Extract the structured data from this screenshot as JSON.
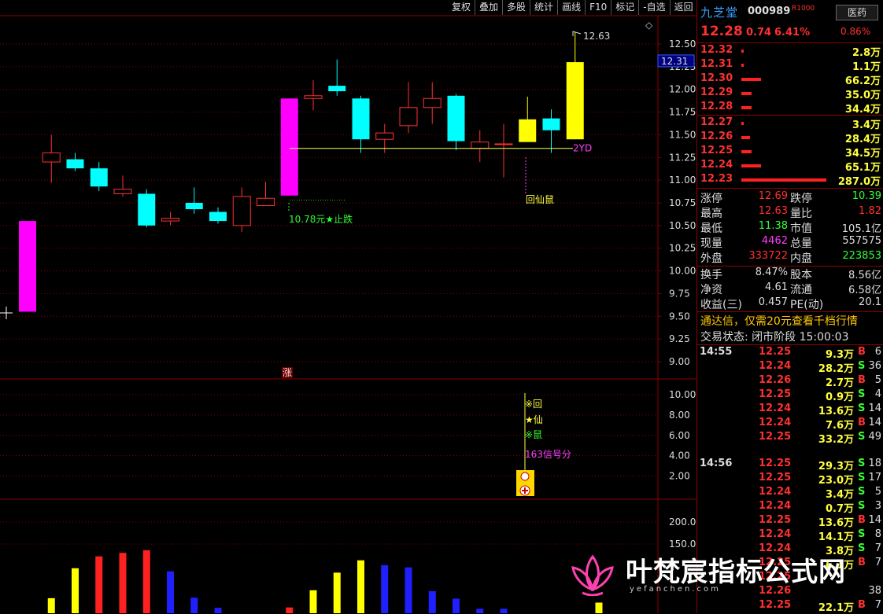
{
  "toolbar": [
    "复权",
    "叠加",
    "多股",
    "统计",
    "画线",
    "F10",
    "标记",
    "-自选",
    "返回"
  ],
  "stock": {
    "name": "九芝堂",
    "code": "000989",
    "tag": "R1000",
    "price": "12.28",
    "change": "0.74",
    "pct": "6.41%",
    "industry": "医药",
    "industry_pct": "0.86%"
  },
  "asks": [
    {
      "price": "12.32",
      "vol": "2.8万",
      "bar": 0.01
    },
    {
      "price": "12.31",
      "vol": "1.1万",
      "bar": 0.004
    },
    {
      "price": "12.30",
      "vol": "66.2万",
      "bar": 0.23
    },
    {
      "price": "12.29",
      "vol": "35.0万",
      "bar": 0.12
    },
    {
      "price": "12.28",
      "vol": "34.4万",
      "bar": 0.12
    }
  ],
  "bids": [
    {
      "price": "12.27",
      "vol": "3.4万",
      "bar": 0.012
    },
    {
      "price": "12.26",
      "vol": "28.4万",
      "bar": 0.1
    },
    {
      "price": "12.25",
      "vol": "34.5万",
      "bar": 0.12
    },
    {
      "price": "12.24",
      "vol": "65.1万",
      "bar": 0.23
    },
    {
      "price": "12.23",
      "vol": "287.0万",
      "bar": 1.0
    }
  ],
  "stats": [
    {
      "l1": "涨停",
      "v1": "12.69",
      "c1": "#ff3030",
      "l2": "跌停",
      "v2": "10.39",
      "c2": "#30ff30"
    },
    {
      "l1": "最高",
      "v1": "12.63",
      "c1": "#ff3030",
      "l2": "量比",
      "v2": "1.82",
      "c2": "#ff3030"
    },
    {
      "l1": "最低",
      "v1": "11.38",
      "c1": "#30ff30",
      "l2": "市值",
      "v2": "105.1亿",
      "c2": "#ddd"
    },
    {
      "l1": "现量",
      "v1": "4462",
      "c1": "#ff40ff",
      "l2": "总量",
      "v2": "557575",
      "c2": "#ddd"
    },
    {
      "l1": "外盘",
      "v1": "333722",
      "c1": "#ff3030",
      "l2": "内盘",
      "v2": "223853",
      "c2": "#30ff30"
    }
  ],
  "stats2": [
    {
      "l1": "换手",
      "v1": "8.47%",
      "c1": "#ddd",
      "l2": "股本",
      "v2": "8.56亿",
      "c2": "#ddd"
    },
    {
      "l1": "净资",
      "v1": "4.61",
      "c1": "#ddd",
      "l2": "流通",
      "v2": "6.58亿",
      "c2": "#ddd"
    },
    {
      "l1": "收益(三)",
      "v1": "0.457",
      "c1": "#ddd",
      "l2": "PE(动)",
      "v2": "20.1",
      "c2": "#ddd"
    }
  ],
  "banner": "通达信，仅需20元查看千档行情",
  "trade_state": "交易状态: 闭市阶段 15:00:03",
  "ticks": [
    {
      "t": "14:55",
      "p": "12.25",
      "v": "9.3万",
      "bs": "B",
      "n": "6"
    },
    {
      "t": "",
      "p": "12.24",
      "v": "28.2万",
      "bs": "S",
      "n": "36"
    },
    {
      "t": "",
      "p": "12.26",
      "v": "2.7万",
      "bs": "B",
      "n": "5"
    },
    {
      "t": "",
      "p": "12.25",
      "v": "0.9万",
      "bs": "S",
      "n": "4"
    },
    {
      "t": "",
      "p": "12.24",
      "v": "13.6万",
      "bs": "S",
      "n": "14"
    },
    {
      "t": "",
      "p": "12.24",
      "v": "7.6万",
      "bs": "B",
      "n": "14"
    },
    {
      "t": "",
      "p": "12.25",
      "v": "33.2万",
      "bs": "S",
      "n": "49"
    },
    {
      "t": "14:56",
      "p": "12.25",
      "v": "29.3万",
      "bs": "S",
      "n": "18"
    },
    {
      "t": "",
      "p": "12.25",
      "v": "23.0万",
      "bs": "S",
      "n": "17"
    },
    {
      "t": "",
      "p": "12.24",
      "v": "3.4万",
      "bs": "S",
      "n": "5"
    },
    {
      "t": "",
      "p": "12.24",
      "v": "0.7万",
      "bs": "S",
      "n": "3"
    },
    {
      "t": "",
      "p": "12.25",
      "v": "13.6万",
      "bs": "B",
      "n": "14"
    },
    {
      "t": "",
      "p": "12.24",
      "v": "14.1万",
      "bs": "S",
      "n": "8"
    },
    {
      "t": "",
      "p": "12.24",
      "v": "3.8万",
      "bs": "S",
      "n": "7"
    },
    {
      "t": "",
      "p": "12.25",
      "v": "6.1万",
      "bs": "B",
      "n": "7"
    },
    {
      "t": "",
      "p": "12.25",
      "v": "",
      "bs": "",
      "n": ""
    },
    {
      "t": "",
      "p": "12.26",
      "v": "",
      "bs": "",
      "n": "38"
    },
    {
      "t": "",
      "p": "12.25",
      "v": "22.1万",
      "bs": "B",
      "n": "7"
    }
  ],
  "main_axis": [
    "12.50",
    "12.25",
    "12.00",
    "11.75",
    "11.50",
    "11.25",
    "11.00",
    "10.75",
    "10.50",
    "10.25",
    "10.00",
    "9.75",
    "9.50",
    "9.25",
    "9.00"
  ],
  "sig_axis": [
    "10.00",
    "8.00",
    "6.00",
    "4.00",
    "2.00"
  ],
  "vol_axis": [
    "200.0",
    "150.0"
  ],
  "current_price_tag": "12.31",
  "labels": {
    "high": "12.63",
    "yd": "2YD",
    "stop": "10.78元★止跌",
    "hxs": "回仙鼠",
    "zhang": "涨",
    "s1": "※回",
    "s2": "★仙",
    "s3": "※鼠",
    "score": "163信号分"
  },
  "candles": [
    {
      "o": 9.55,
      "c": 10.55,
      "h": 10.55,
      "l": 9.55,
      "col": "magenta"
    },
    {
      "o": 11.2,
      "c": 11.3,
      "h": 11.5,
      "l": 10.97,
      "col": "red"
    },
    {
      "o": 11.23,
      "c": 11.13,
      "h": 11.3,
      "l": 11.1,
      "col": "cyan"
    },
    {
      "o": 11.13,
      "c": 10.93,
      "h": 11.2,
      "l": 10.88,
      "col": "cyan"
    },
    {
      "o": 10.85,
      "c": 10.9,
      "h": 11.05,
      "l": 10.82,
      "col": "red"
    },
    {
      "o": 10.85,
      "c": 10.5,
      "h": 10.9,
      "l": 10.48,
      "col": "cyan"
    },
    {
      "o": 10.55,
      "c": 10.58,
      "h": 10.65,
      "l": 10.5,
      "col": "red"
    },
    {
      "o": 10.75,
      "c": 10.68,
      "h": 10.92,
      "l": 10.63,
      "col": "cyan"
    },
    {
      "o": 10.65,
      "c": 10.55,
      "h": 10.7,
      "l": 10.52,
      "col": "cyan"
    },
    {
      "o": 10.5,
      "c": 10.82,
      "h": 10.92,
      "l": 10.43,
      "col": "red"
    },
    {
      "o": 10.72,
      "c": 10.8,
      "h": 10.98,
      "l": 10.72,
      "col": "red"
    },
    {
      "o": 10.83,
      "c": 11.9,
      "h": 11.9,
      "l": 10.83,
      "col": "magenta"
    },
    {
      "o": 11.9,
      "c": 11.93,
      "h": 12.1,
      "l": 11.77,
      "col": "red"
    },
    {
      "o": 12.04,
      "c": 11.98,
      "h": 12.33,
      "l": 11.93,
      "col": "cyan"
    },
    {
      "o": 11.9,
      "c": 11.45,
      "h": 11.93,
      "l": 11.3,
      "col": "cyan"
    },
    {
      "o": 11.45,
      "c": 11.52,
      "h": 11.62,
      "l": 11.3,
      "col": "red"
    },
    {
      "o": 11.6,
      "c": 11.8,
      "h": 12.08,
      "l": 11.52,
      "col": "red"
    },
    {
      "o": 11.8,
      "c": 11.9,
      "h": 12.08,
      "l": 11.62,
      "col": "red"
    },
    {
      "o": 11.93,
      "c": 11.43,
      "h": 11.95,
      "l": 11.33,
      "col": "cyan"
    },
    {
      "o": 11.35,
      "c": 11.42,
      "h": 11.55,
      "l": 11.2,
      "col": "red"
    },
    {
      "o": 11.4,
      "c": 11.4,
      "h": 11.62,
      "l": 11.03,
      "col": "red"
    },
    {
      "o": 11.42,
      "c": 11.67,
      "h": 11.92,
      "l": 11.42,
      "col": "yellow"
    },
    {
      "o": 11.68,
      "c": 11.55,
      "h": 11.78,
      "l": 11.3,
      "col": "cyan"
    },
    {
      "o": 11.45,
      "c": 12.3,
      "h": 12.63,
      "l": 11.45,
      "col": "yellow"
    }
  ],
  "volume_bars": [
    {
      "v": 27,
      "col": "yellow"
    },
    {
      "v": 95,
      "col": "yellow"
    },
    {
      "v": 122,
      "col": "red"
    },
    {
      "v": 130,
      "col": "red"
    },
    {
      "v": 136,
      "col": "red"
    },
    {
      "v": 88,
      "col": "blue"
    },
    {
      "v": 28,
      "col": "blue"
    },
    {
      "v": 5,
      "col": "blue"
    },
    {
      "v": 0,
      "col": "blue"
    },
    {
      "v": 0,
      "col": "blue"
    },
    {
      "v": 6,
      "col": "red"
    },
    {
      "v": 45,
      "col": "yellow"
    },
    {
      "v": 85,
      "col": "yellow"
    },
    {
      "v": 113,
      "col": "yellow"
    },
    {
      "v": 102,
      "col": "blue"
    },
    {
      "v": 97,
      "col": "blue"
    },
    {
      "v": 43,
      "col": "blue"
    },
    {
      "v": 26,
      "col": "blue"
    },
    {
      "v": 3,
      "col": "blue"
    },
    {
      "v": 3,
      "col": "blue"
    },
    {
      "v": 0,
      "col": "blue"
    },
    {
      "v": 0,
      "col": "blue"
    },
    {
      "v": 0,
      "col": "blue"
    },
    {
      "v": 17,
      "col": "yellow"
    }
  ],
  "support_line": 11.35,
  "stop_line": 10.78,
  "watermark": {
    "text": "叶梵宸指标公式网",
    "sub": "yefanchen.com"
  }
}
